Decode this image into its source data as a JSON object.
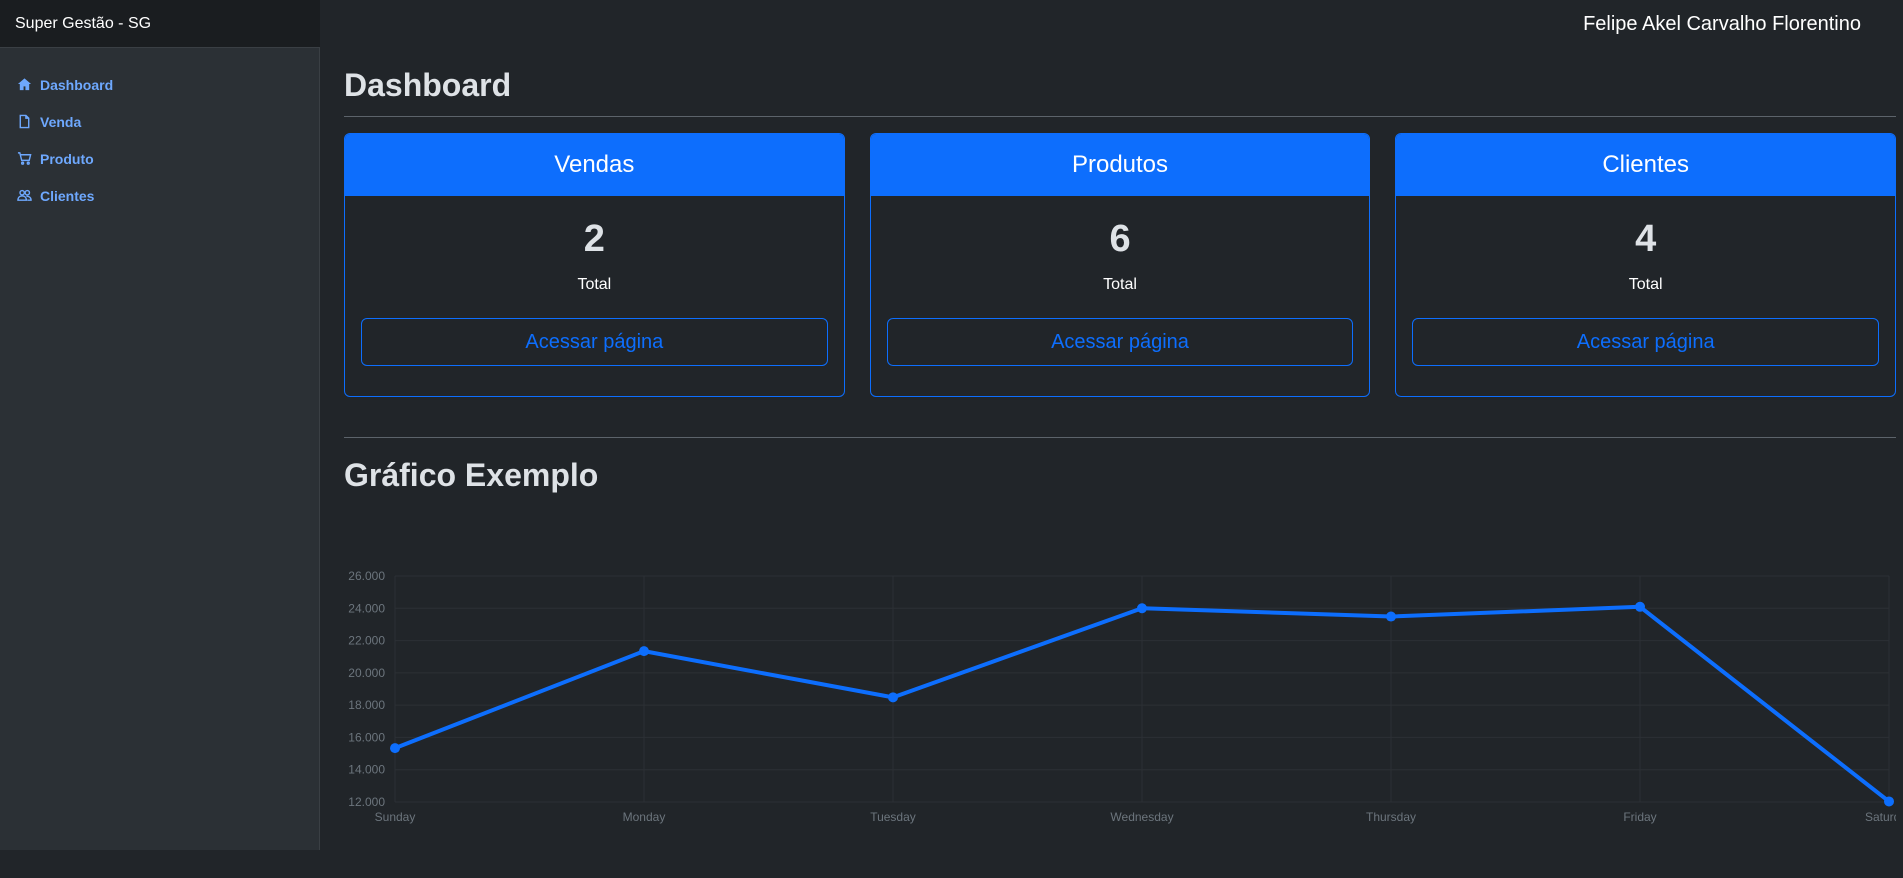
{
  "brand": "Super Gestão - SG",
  "user_name": "Felipe Akel Carvalho Florentino",
  "sidebar": {
    "items": [
      {
        "label": "Dashboard",
        "icon": "home-icon"
      },
      {
        "label": "Venda",
        "icon": "file-icon"
      },
      {
        "label": "Produto",
        "icon": "cart-icon"
      },
      {
        "label": "Clientes",
        "icon": "people-icon"
      }
    ]
  },
  "main": {
    "title": "Dashboard",
    "cards": [
      {
        "title": "Vendas",
        "value": "2",
        "caption": "Total",
        "button": "Acessar página"
      },
      {
        "title": "Produtos",
        "value": "6",
        "caption": "Total",
        "button": "Acessar página"
      },
      {
        "title": "Clientes",
        "value": "4",
        "caption": "Total",
        "button": "Acessar página"
      }
    ],
    "chart_title": "Gráfico Exemplo"
  },
  "colors": {
    "accent": "#0d6efd",
    "line": "#0d6efd",
    "background": "#212529",
    "sidebar": "#2b3035"
  },
  "chart_data": {
    "type": "line",
    "categories": [
      "Sunday",
      "Monday",
      "Tuesday",
      "Wednesday",
      "Thursday",
      "Friday",
      "Saturday"
    ],
    "values": [
      15339,
      21345,
      18483,
      24003,
      23489,
      24092,
      12034
    ],
    "ylim": [
      12000,
      26000
    ],
    "yticks": [
      "12.000",
      "14.000",
      "16.000",
      "18.000",
      "20.000",
      "22.000",
      "24.000",
      "26.000"
    ],
    "grid": true,
    "legend": "none"
  }
}
